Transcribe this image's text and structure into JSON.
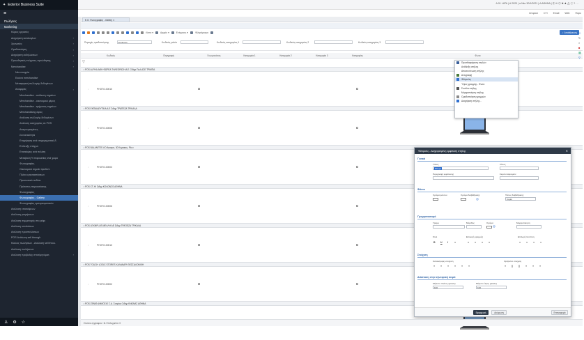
{
  "app": {
    "title": "Exterior Business Suite"
  },
  "sidebar": {
    "items": [
      {
        "label": "Πωλήσεις",
        "level": "top"
      },
      {
        "label": "Marketing",
        "level": "top",
        "active": true
      },
      {
        "label": "Κύριες εργασίες",
        "level": "sub"
      },
      {
        "label": "Διαχείριση καταλογίων",
        "level": "sub",
        "chev": true
      },
      {
        "label": "Χρονοτίες",
        "level": "sub",
        "chev": true
      },
      {
        "label": "Ομαδοποίηση",
        "level": "sub",
        "chev": true
      },
      {
        "label": "Διαχείριση εκδηλώσεων",
        "level": "sub",
        "chev": true
      },
      {
        "label": "Προωθητικές ενέργειες προώθησης",
        "level": "sub",
        "chev": true
      },
      {
        "label": "Merchandise",
        "level": "sub",
        "chev": true
      },
      {
        "label": "Νέα στοιχεία",
        "level": "sub2"
      },
      {
        "label": "Εικόνα merchandise",
        "level": "sub2"
      },
      {
        "label": "Μεταφορική συλλογής δεδομένων",
        "level": "sub2"
      },
      {
        "label": "Αναφορές",
        "level": "sub2",
        "chev": true
      },
      {
        "label": "Merchandise - ανάλυση σημείων",
        "level": "sub3"
      },
      {
        "label": "Merchandise - οικονομικό μέρος",
        "level": "sub3"
      },
      {
        "label": "Merchandise - τμήματος σημείων",
        "level": "sub3"
      },
      {
        "label": "Merchandising όψεις",
        "level": "sub3"
      },
      {
        "label": "Ανάλυση συλλογής δεδομένων",
        "level": "sub3"
      },
      {
        "label": "Ανάλυση κατηγορίας σε POS",
        "level": "sub3"
      },
      {
        "label": "Αναγνωρισμένες",
        "level": "sub3"
      },
      {
        "label": "Συνεκτικότητα",
        "level": "sub3"
      },
      {
        "label": "Επιχείρηση ανά επιχειρηματική δ.",
        "level": "sub3"
      },
      {
        "label": "Επίτευξη στόχων",
        "level": "sub3"
      },
      {
        "label": "Επισκέψεις ανά πελάτη",
        "level": "sub3"
      },
      {
        "label": "Μεταβολή % παρουσίας ανά χώρο",
        "level": "sub3"
      },
      {
        "label": "Φωτογραφίες",
        "level": "sub3"
      },
      {
        "label": "Οικονομικά σημεία προϊόντ.",
        "level": "sub3"
      },
      {
        "label": "Πλάνα εγκαταστάσεων",
        "level": "sub3"
      },
      {
        "label": "Προσωπικό πεδίου",
        "level": "sub3"
      },
      {
        "label": "Πρότυπες παρουσίασης",
        "level": "sub3"
      },
      {
        "label": "Φωτογραφίες",
        "level": "sub3"
      },
      {
        "label": "Φωτογραφίες - Gallery",
        "level": "sub3",
        "hl": true
      },
      {
        "label": "Φωτογραφίες εμπορευματικών",
        "level": "sub3"
      },
      {
        "label": "Ανάλυση επισκέψεων",
        "level": "sub"
      },
      {
        "label": "Ανάλυση μετρήσεων",
        "level": "sub"
      },
      {
        "label": "Ανάλυση συμμετοχής στο ράφι",
        "level": "sub"
      },
      {
        "label": "Ανάλυση υπολοίπων",
        "level": "sub"
      },
      {
        "label": "Ανάλυση προσπελάσεων",
        "level": "sub"
      },
      {
        "label": "POS Ανάλυση sell through",
        "level": "sub"
      },
      {
        "label": "Κύκλος πωλήσεων - Ανάλυση sell throu.",
        "level": "sub"
      },
      {
        "label": "Ανάλυση πωλήσεων",
        "level": "sub"
      },
      {
        "label": "Ανάλυση προβολής σποτ/μηνύματ.",
        "level": "sub",
        "chev": true
      }
    ]
  },
  "topbar": {
    "info": "Δ 01 LATA  |  Δ 2020  |  ● Νέο 30/1/2021  |  Δ ΑΘΗΝΑ  |  Ⓔ ✉ ◎ ✖ ♟ ⚠ ⓘ ? ⋯",
    "util": [
      "Ιστορικό",
      "CTI",
      "Email",
      "Web",
      "Παρο"
    ]
  },
  "tab": {
    "label": "E.O. Φωτογραφίες - Gallery ✕"
  },
  "toolbar": {
    "labels": [
      "Λίστα ▾",
      "Αρχείο ▾",
      "Ενέργειες ▾",
      "Φιλτράρισμα"
    ],
    "right_button": "✓ Αποθήκευση"
  },
  "filters": {
    "area_label": "Περιοχές ομαδοποίησης",
    "area_value": "Επίθεσαν",
    "fields": [
      "Κωδικός γαλέα",
      "Κωδικός κατηγορίας 1",
      "Κωδικός κατηγορίας 2",
      "Κωδικός κατηγορίας 3"
    ]
  },
  "columns": [
    "Κωδικός",
    "Περιγραφή",
    "Γεωφ εικόνας",
    "Κατηγορία 1",
    "Κατηγορία 2",
    "Κατηγορία 3",
    "Κατηγορίες",
    "Φωτο"
  ],
  "groups": [
    {
      "label": "▪ POS  ALPHA ΑΘΗ ΦΩΡΕΑ ΤΗΛΕΟΡΑΣΗ Α.Ε. Σιδηρ Πωλ ΑΣΕ ΤΡΙΜΠΑ",
      "code": "PHOTO-00010"
    },
    {
      "label": "▪ POS  ΕΚΠΑΙΔΕΥΤΙΚΑ Α.Ε Σιδηρ ΤΡΑΠΕΖΑ ΤΡΙΚΑΛΑ",
      "code": "PHOTO-00008"
    },
    {
      "label": "▪ POS  BALANITES ΛΟ Ακαρνα, 30 Κυριακες, Ρίο ε",
      "code": "PHOTO-00003"
    },
    {
      "label": "▪ POS  CT-HI Σιδηρ ΚΟΛΩΝΟΣ ΑΘΗΝΑ",
      "code": "PHOTO-00006"
    },
    {
      "label": "▪ POS  LEXMPLUS ΜΕΛΛΗ ΑΕ Σιδηρ ΤΡΑΠΕΖΑ ΤΡΙΚΑΛΑ",
      "code": "PHOTO-00013"
    },
    {
      "label": "▪ POS  TOUCH LOGIC STORES ΧΑΛΑΝΔΡΙ ΘΕΣΣΑΛΟΝΙΚΗ",
      "code": "PHOTO-00002"
    },
    {
      "label": "▪ POS  ΖΕΝΙΘ ΔΗΜΟΣΙΟ Σ.Α. Σοτιρίου Σιδηρ ΚΝΩΝΑΣ ΑΘΗΝΑ",
      "code": "PHOTO-00001"
    }
  ],
  "context_menu": {
    "items": [
      {
        "label": "Προσθαφαίρεση στηλών",
        "color": "#3a5f9a"
      },
      {
        "label": "Ανάδειξη στήλης",
        "color": ""
      },
      {
        "label": "Αποσυνένωση στήλης",
        "color": ""
      },
      {
        "label": "Αντιγραφή",
        "color": "#4a7a3a"
      },
      {
        "label": "Φίλτρο/ες",
        "color": "#2f6fcf",
        "selected": true
      },
      {
        "label": "Ύψος γραμμής - Φωτο",
        "color": ""
      },
      {
        "label": "Συνόλα στήλης",
        "color": "#555"
      },
      {
        "label": "Μορφοποίηση στήλης",
        "color": ""
      },
      {
        "label": "Ομαδοποίηση γραμμών",
        "color": "#8a8a8a"
      },
      {
        "label": "Διαχείριση στήλης...",
        "color": "#2f6fcf"
      }
    ]
  },
  "dialog": {
    "title": "Φίλτρο/ες - Διαχειρισμένη εμφάνιση στήλης",
    "close": "✕",
    "sections": {
      "general": "Γενικά",
      "color": "Φόντο",
      "font": "Γραμματοσειρά",
      "align": "Στοίχιση",
      "width": "Διάσταση στην εξωτερική σειρά"
    },
    "labels": {
      "title": "Τίτλος",
      "type": "Τύπος",
      "desc": "Περιγραφή εμφάνισης",
      "exp": "Σειρά εταιρισμών",
      "bg": "Χρώμα φόντου",
      "color_bg": "Χρώμα διαβάθμισης",
      "grad_type": "Τύπος διαβάθμισης",
      "grad_value": "Καμία",
      "family": "Γραμμ",
      "size": "Μέγεθος",
      "color": "Χρώμα",
      "fade": "Μορφοποίηση",
      "style": "Στυλ",
      "style_title": "Επιλογή γραμμής",
      "style_desc": "Επιλογή ταυτίτση",
      "align_header": "Κατακόρυφη στοίχιση",
      "align_col": "Οριζόντια στοίχιση",
      "min_width": "Μέγιστο πλάτος (pixels)",
      "min_height": "Μέγιστο ύψος (pixels)"
    },
    "values": {
      "title": "Φίλτρο",
      "min_width": "100",
      "min_height": "100"
    },
    "buttons": {
      "apply": "Εφαρμογή",
      "cancel": "Ακύρωση",
      "restore": "Επαναφορά"
    }
  },
  "statusbar": {
    "text": "Σύνολο εγγραφών: 11 Επιλεγμένα: 0"
  }
}
